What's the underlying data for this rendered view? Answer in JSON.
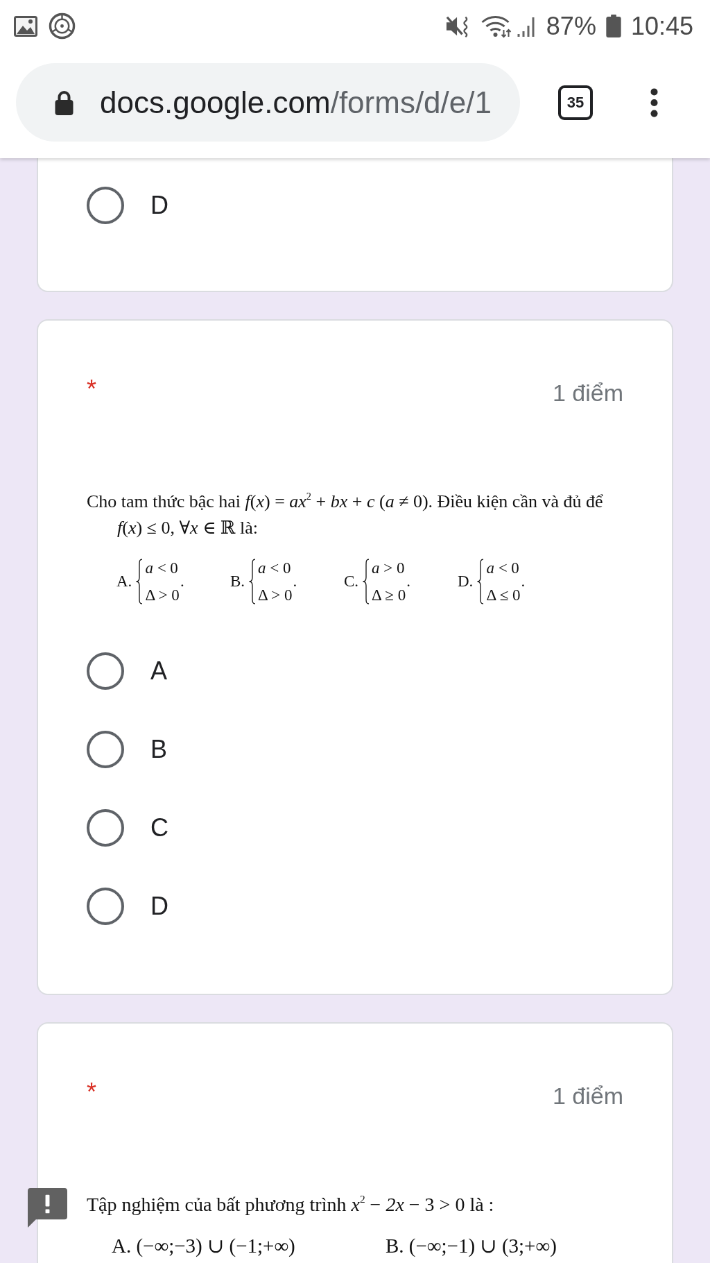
{
  "status_bar": {
    "battery": "87%",
    "time": "10:45"
  },
  "address_bar": {
    "url": {
      "host": "docs.google.com",
      "path": "/forms/d/e/1"
    },
    "tab_count": "35"
  },
  "questions": [
    {
      "kind": "continued",
      "options": [
        {
          "label": "D",
          "selected": false
        }
      ]
    },
    {
      "kind": "question",
      "required_mark": "*",
      "points": "1 điểm",
      "alert": false,
      "prompt": "Cho tam thức bậc hai *f*(*x*) = *ax*$^{2}$ + *bx* + *c* (*a* ≠ 0). Điều kiện cần và đủ để *f*(*x*) ≤ 0, ∀*x* ∈ ℝ là:",
      "choices": [
        {
          "kind": "system",
          "label": "A.",
          "lines": [
            "*a* < 0",
            "Δ > 0"
          ],
          "end": "."
        },
        {
          "kind": "system",
          "label": "B.",
          "lines": [
            "*a* < 0",
            "Δ > 0"
          ],
          "end": "."
        },
        {
          "kind": "system",
          "label": "C.",
          "lines": [
            "*a* > 0",
            "Δ ≥ 0"
          ],
          "end": "."
        },
        {
          "kind": "system",
          "label": "D.",
          "lines": [
            "*a* < 0",
            "Δ ≤ 0"
          ],
          "end": "."
        }
      ],
      "options": [
        {
          "label": "A",
          "selected": false
        },
        {
          "label": "B",
          "selected": false
        },
        {
          "label": "C",
          "selected": false
        },
        {
          "label": "D",
          "selected": false
        }
      ]
    },
    {
      "kind": "question",
      "required_mark": "*",
      "points": "1 điểm",
      "alert": true,
      "prompt": "Tập nghiệm của bất phương trình *x*$^{2}$ − *2x* − 3 > 0 là :",
      "choices": [
        {
          "kind": "plain",
          "text": "A. (−∞;−3) ∪ (−1;+∞)"
        },
        {
          "kind": "plain",
          "text": "B. (−∞;−1) ∪ (3;+∞)"
        }
      ]
    }
  ]
}
